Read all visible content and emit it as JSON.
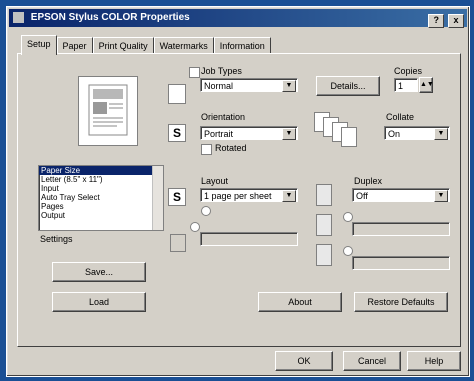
{
  "window": {
    "title": "EPSON Stylus COLOR Properties"
  },
  "titlebar_buttons": {
    "help": "?",
    "close": "x"
  },
  "tabs": [
    "Setup",
    "Paper",
    "Print Quality",
    "Watermarks",
    "Information"
  ],
  "job_type": {
    "label": "Job Types",
    "value": "Normal",
    "details_button": "Details..."
  },
  "copies": {
    "label": "Copies",
    "value": "1"
  },
  "orientation": {
    "label": "Orientation",
    "value": "Portrait",
    "rotated_label": "Rotated"
  },
  "collate": {
    "label": "Collate",
    "value": "On"
  },
  "layout": {
    "label": "Layout",
    "value": "1 page per sheet"
  },
  "duplex": {
    "label": "Duplex",
    "value": "Off"
  },
  "settings_list": {
    "items": [
      "Paper Size",
      "Letter (8.5\" x 11\")",
      "Input",
      "Auto Tray Select",
      "Pages",
      "Output"
    ],
    "selected_index": 0
  },
  "settings_label": "Settings",
  "buttons": {
    "save": "Save...",
    "load": "Load",
    "about": "About",
    "restore_defaults": "Restore Defaults",
    "ok": "OK",
    "cancel": "Cancel",
    "help": "Help"
  },
  "icons": {
    "job_type": "document-icon",
    "orientation": "S",
    "layout": "S",
    "collate": "stacked-pages-icon"
  }
}
